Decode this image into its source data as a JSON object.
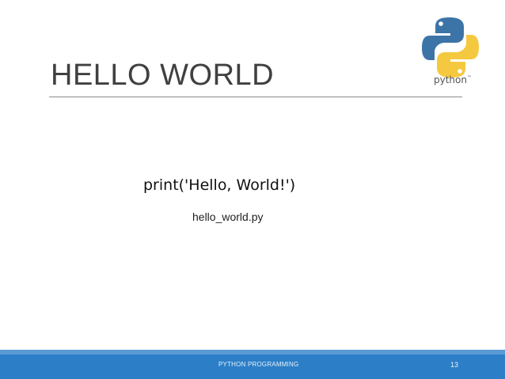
{
  "slide": {
    "title": "HELLO WORLD",
    "logo": {
      "icon": "python-logo-icon",
      "text": "python",
      "trademark": "™"
    },
    "code_line": "print('Hello, World!')",
    "code_caption": "hello_world.py",
    "footer": {
      "text": "PYTHON PROGRAMMING",
      "page_number": "13"
    }
  },
  "colors": {
    "title": "#404040",
    "rule": "#8c8c8c",
    "python_blue": "#3d74a8",
    "python_yellow": "#f5c93f",
    "footer_bar": "#2c7fc7",
    "footer_accent": "#5b9bd5"
  }
}
